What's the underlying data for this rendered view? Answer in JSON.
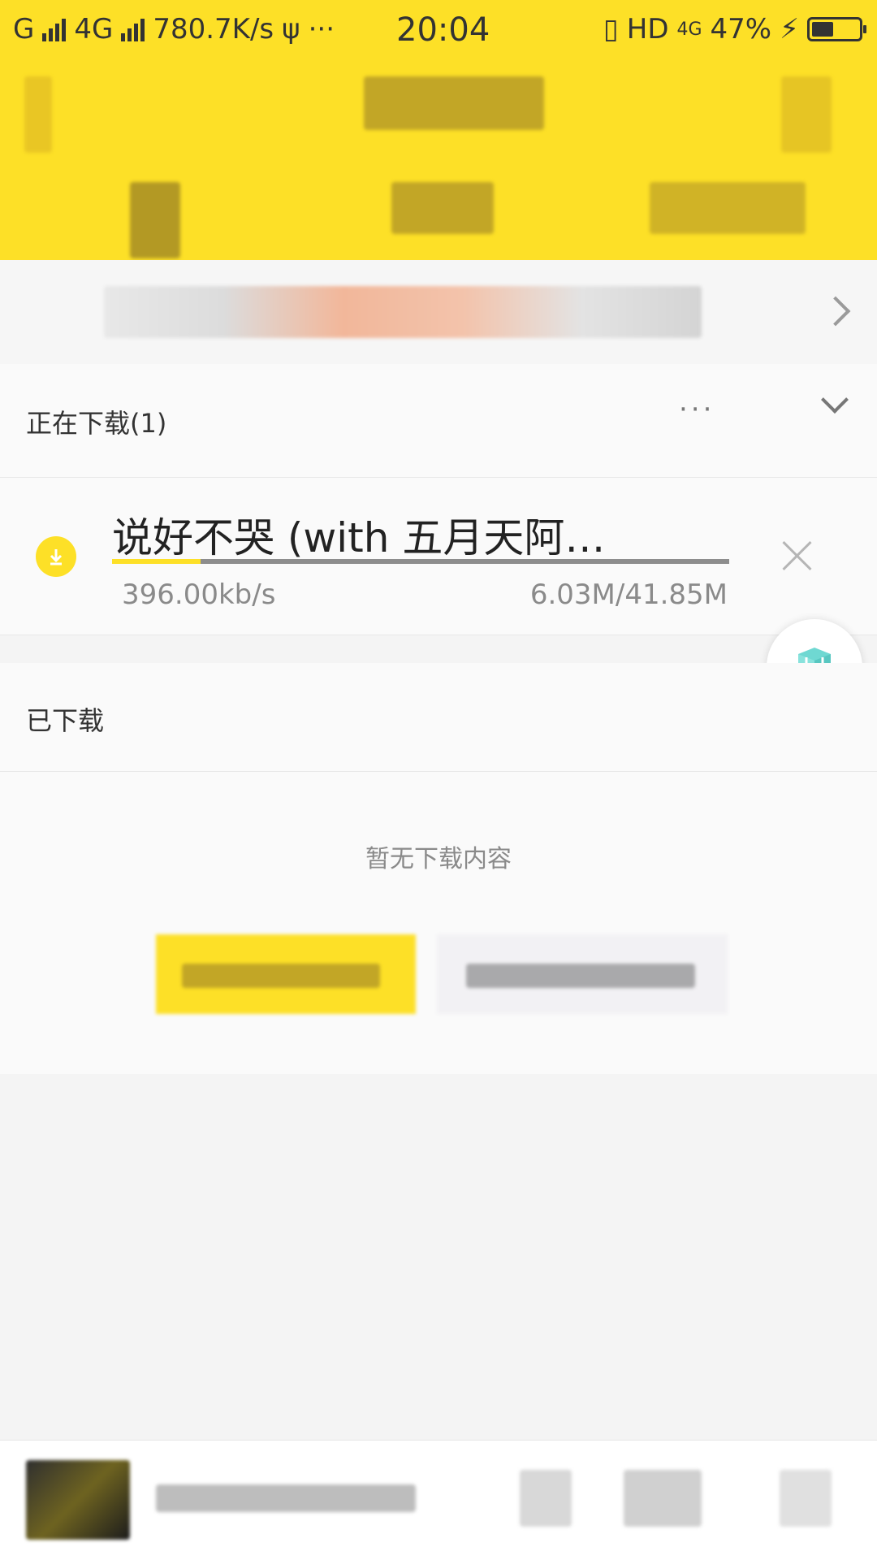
{
  "status_bar": {
    "carrier": "G",
    "network": "4G",
    "speed": "780.7K/s",
    "extras": "···",
    "time": "20:04",
    "hd": "HD",
    "network2": "4G",
    "battery": "47%"
  },
  "downloading": {
    "title": "正在下载(1)",
    "more": "···",
    "item": {
      "name": "说好不哭 (with 五月天阿…",
      "speed": "396.00kb/s",
      "size": "6.03M/41.85M",
      "progress": 0.144
    }
  },
  "downloaded": {
    "title": "已下载",
    "empty_text": "暂无下载内容"
  },
  "colors": {
    "accent": "#fde027",
    "floating_icon": "#6fd8d2"
  },
  "icons": {
    "download": "download-arrow-icon",
    "close": "close-icon",
    "chevron": "chevron-right-icon",
    "collapse": "chevron-down-icon",
    "floating": "cube-icon"
  }
}
